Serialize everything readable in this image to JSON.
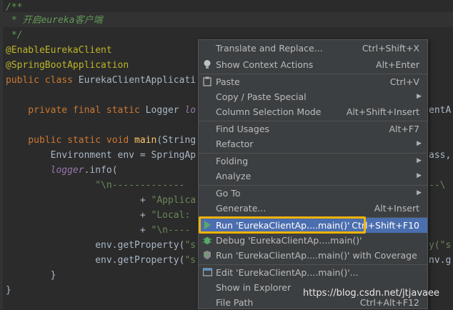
{
  "code": {
    "lines": [
      "/**",
      " * 开启eureka客户端",
      " */",
      "@EnableEurekaClient",
      "@SpringBootApplication",
      "public class EurekaClientApplicati",
      "",
      "    private final static Logger lo",
      "",
      "    public static void main(String",
      "        Environment env = SpringAp",
      "        logger.info(",
      "                \"\\n-------------",
      "                        + \"Applica",
      "                        + \"Local: ",
      "                        + \"\\n----",
      "                env.getProperty(\"s",
      "                env.getProperty(\"s",
      "        }",
      "}"
    ],
    "right_fragments": [
      "entA",
      "ass,",
      "--\\",
      "y(\"s",
      "nv.g"
    ]
  },
  "menu": {
    "items": [
      {
        "label": "Translate and Replace...",
        "shortcut": "Ctrl+Shift+X",
        "icon": ""
      },
      {
        "label": "Show Context Actions",
        "shortcut": "Alt+Enter",
        "icon": "lightbulb-icon"
      },
      {
        "label": "Paste",
        "shortcut": "Ctrl+V",
        "icon": "clipboard-icon"
      },
      {
        "label": "Copy / Paste Special",
        "shortcut": "",
        "icon": "",
        "submenu": true
      },
      {
        "label": "Column Selection Mode",
        "shortcut": "Alt+Shift+Insert",
        "icon": ""
      },
      {
        "label": "Find Usages",
        "shortcut": "Alt+F7",
        "icon": ""
      },
      {
        "label": "Refactor",
        "shortcut": "",
        "icon": "",
        "submenu": true
      },
      {
        "label": "Folding",
        "shortcut": "",
        "icon": "",
        "submenu": true
      },
      {
        "label": "Analyze",
        "shortcut": "",
        "icon": "",
        "submenu": true
      },
      {
        "label": "Go To",
        "shortcut": "",
        "icon": "",
        "submenu": true
      },
      {
        "label": "Generate...",
        "shortcut": "Alt+Insert",
        "icon": ""
      },
      {
        "label": "Run 'EurekaClientAp....main()'",
        "shortcut": "Ctrl+Shift+F10",
        "icon": "run-icon",
        "selected": true
      },
      {
        "label": "Debug 'EurekaClientAp....main()'",
        "shortcut": "",
        "icon": "debug-icon"
      },
      {
        "label": "Run 'EurekaClientAp....main()' with Coverage",
        "shortcut": "",
        "icon": "coverage-icon"
      },
      {
        "label": "Edit 'EurekaClientAp....main()'...",
        "shortcut": "",
        "icon": "edit-config-icon"
      },
      {
        "label": "Show in Explorer",
        "shortcut": "",
        "icon": ""
      },
      {
        "label": "File Path",
        "shortcut": "Ctrl+Alt+F12",
        "icon": ""
      }
    ]
  },
  "watermark": "https://blog.csdn.net/jtjavaee",
  "colors": {
    "menu_bg": "#3c3f41",
    "selection": "#4b6eaf",
    "highlight_box": "#f0b400",
    "editor_bg": "#2b2b2b"
  }
}
